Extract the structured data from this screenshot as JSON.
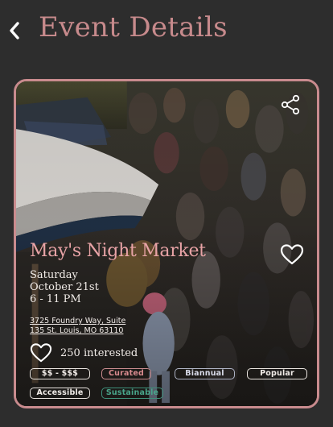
{
  "header": {
    "title": "Event Details",
    "back_icon": "chevron-left-icon"
  },
  "event": {
    "name": "May's Night Market",
    "day": "Saturday",
    "date": "October 21st",
    "time": "6 - 11 PM",
    "address_line1": "3725 Foundry Way, Suite",
    "address_line2": "135 St. Louis, MO 63110",
    "interested_count": "250 interested",
    "share_icon": "share-icon",
    "favorite_icon": "heart-outline-icon"
  },
  "tags": [
    {
      "label": "$$ - $$$",
      "color": "#e9e4df"
    },
    {
      "label": "Curated",
      "color": "#c98b8e"
    },
    {
      "label": "Biannual",
      "color": "#aeb3c4"
    },
    {
      "label": "Popular",
      "color": "#e9e4df"
    },
    {
      "label": "Accessible",
      "color": "#e9e4df"
    },
    {
      "label": "Sustainable",
      "color": "#3f8f7a"
    }
  ],
  "colors": {
    "background": "#2d2d2d",
    "accent": "#c98b8e",
    "title": "#c78a8c",
    "text": "#f1ece8"
  }
}
